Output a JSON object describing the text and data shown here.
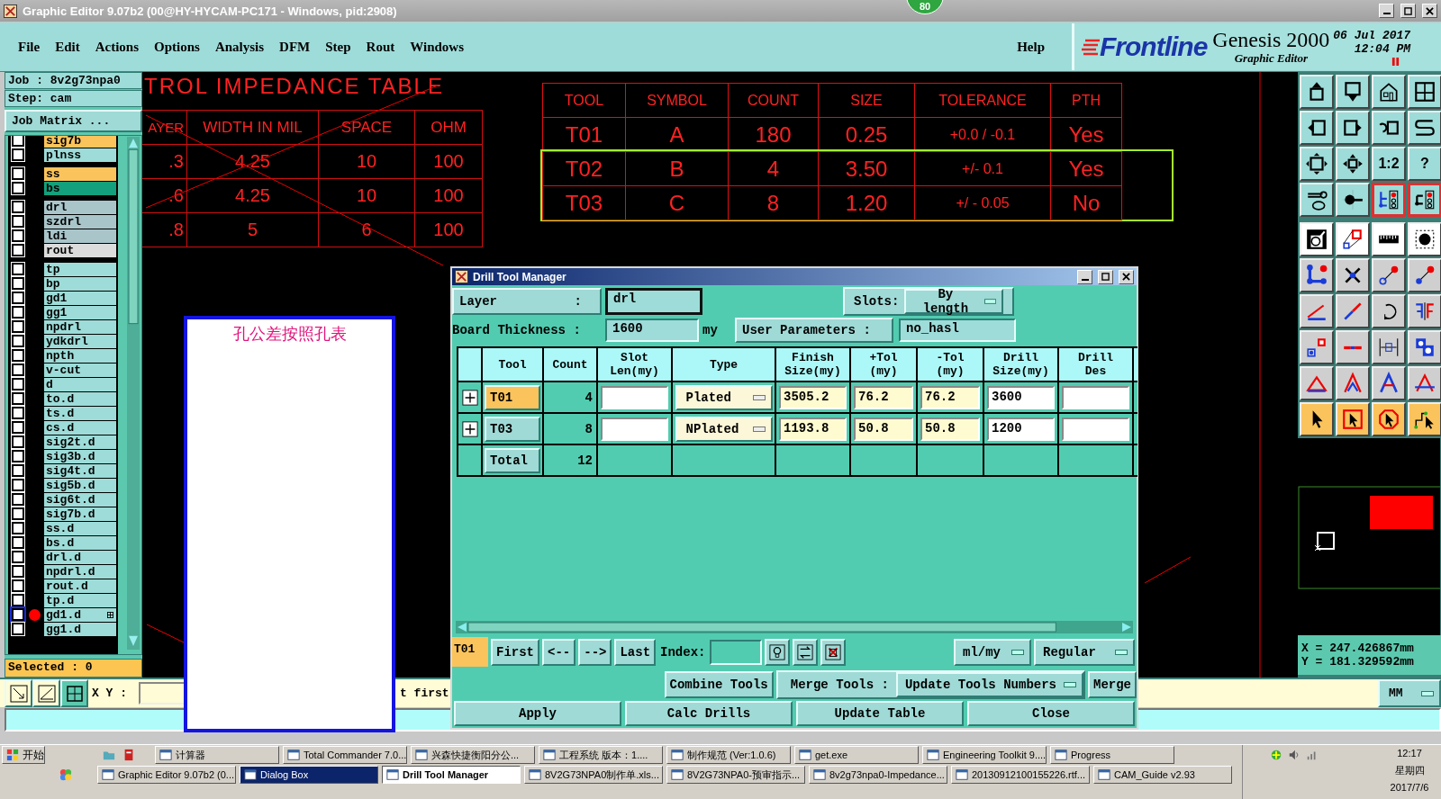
{
  "window": {
    "title": "Graphic Editor 9.07b2 (00@HY-HYCAM-PC171 - Windows, pid:2908)",
    "badge": "80"
  },
  "menu": [
    {
      "label": "File"
    },
    {
      "label": "Edit"
    },
    {
      "label": "Actions"
    },
    {
      "label": "Options"
    },
    {
      "label": "Analysis"
    },
    {
      "label": "DFM"
    },
    {
      "label": "Step"
    },
    {
      "label": "Rout"
    },
    {
      "label": "Windows"
    }
  ],
  "help": "Help",
  "brand": {
    "logo": "Frontline",
    "product": "Genesis 2000",
    "subtitle": "Graphic Editor",
    "date": "06 Jul 2017",
    "time": "12:04 PM"
  },
  "job_panel": {
    "job": "Job : 8v2g73npa0",
    "step": "Step: cam",
    "matrix_button": "Job Matrix ...",
    "selected": "Selected : 0",
    "layer_groups": [
      {
        "layers": [
          {
            "name": "sig7b",
            "color": "#fbc35b",
            "checked": false,
            "current": false
          },
          {
            "name": "plnss",
            "color": "#9ddcd8",
            "checked": false,
            "current": false
          }
        ]
      },
      {
        "layers": [
          {
            "name": "ss",
            "color": "#fbc35b",
            "checked": false,
            "current": false
          },
          {
            "name": "bs",
            "color": "#13a07c",
            "checked": false,
            "current": false
          }
        ]
      },
      {
        "layers": [
          {
            "name": "drl",
            "color": "#a9c5ca",
            "checked": false,
            "current": false
          },
          {
            "name": "szdrl",
            "color": "#a9c5ca",
            "checked": false,
            "current": false
          },
          {
            "name": "ldi",
            "color": "#a9c5ca",
            "checked": false,
            "current": false
          },
          {
            "name": "rout",
            "color": "#dcdcdc",
            "checked": false,
            "current": false
          }
        ]
      },
      {
        "layers": [
          {
            "name": "tp",
            "color": "#9ddcd8",
            "checked": false,
            "current": false
          },
          {
            "name": "bp",
            "color": "#9ddcd8",
            "checked": false,
            "current": false
          },
          {
            "name": "gd1",
            "color": "#9ddcd8",
            "checked": false,
            "current": false
          },
          {
            "name": "gg1",
            "color": "#9ddcd8",
            "checked": false,
            "current": false
          },
          {
            "name": "npdrl",
            "color": "#9ddcd8",
            "checked": false,
            "current": false
          },
          {
            "name": "ydkdrl",
            "color": "#9ddcd8",
            "checked": false,
            "current": false
          },
          {
            "name": "npth",
            "color": "#9ddcd8",
            "checked": false,
            "current": false
          },
          {
            "name": "v-cut",
            "color": "#9ddcd8",
            "checked": false,
            "current": false
          },
          {
            "name": "d",
            "color": "#9ddcd8",
            "checked": false,
            "current": false
          },
          {
            "name": "to.d",
            "color": "#9ddcd8",
            "checked": false,
            "current": false
          },
          {
            "name": "ts.d",
            "color": "#9ddcd8",
            "checked": false,
            "current": false
          },
          {
            "name": "cs.d",
            "color": "#9ddcd8",
            "checked": false,
            "current": false
          },
          {
            "name": "sig2t.d",
            "color": "#9ddcd8",
            "checked": false,
            "current": false
          },
          {
            "name": "sig3b.d",
            "color": "#9ddcd8",
            "checked": false,
            "current": false
          },
          {
            "name": "sig4t.d",
            "color": "#9ddcd8",
            "checked": false,
            "current": false
          },
          {
            "name": "sig5b.d",
            "color": "#9ddcd8",
            "checked": false,
            "current": false
          },
          {
            "name": "sig6t.d",
            "color": "#9ddcd8",
            "checked": false,
            "current": false
          },
          {
            "name": "sig7b.d",
            "color": "#9ddcd8",
            "checked": false,
            "current": false
          },
          {
            "name": "ss.d",
            "color": "#9ddcd8",
            "checked": false,
            "current": false
          },
          {
            "name": "bs.d",
            "color": "#9ddcd8",
            "checked": false,
            "current": false
          },
          {
            "name": "drl.d",
            "color": "#9ddcd8",
            "checked": false,
            "current": false
          },
          {
            "name": "npdrl.d",
            "color": "#9ddcd8",
            "checked": false,
            "current": false
          },
          {
            "name": "rout.d",
            "color": "#9ddcd8",
            "checked": false,
            "current": false
          },
          {
            "name": "tp.d",
            "color": "#9ddcd8",
            "checked": false,
            "current": false
          },
          {
            "name": "gd1.d",
            "color": "#9ddcd8",
            "checked": false,
            "current": true
          },
          {
            "name": "gg1.d",
            "color": "#9ddcd8",
            "checked": false,
            "current": false
          }
        ]
      }
    ]
  },
  "impedance_table": {
    "title": "TROL IMPEDANCE TABLE",
    "columns": [
      "AYER",
      "WIDTH IN MIL",
      "SPACE",
      "OHM"
    ],
    "rows": [
      [
        ".3",
        "4.25",
        "10",
        "100"
      ],
      [
        ".6",
        "4.25",
        "10",
        "100"
      ],
      [
        ".8",
        "5",
        "6",
        "100"
      ]
    ]
  },
  "drill_table": {
    "columns": [
      "TOOL",
      "SYMBOL",
      "COUNT",
      "SIZE",
      "TOLERANCE",
      "PTH"
    ],
    "rows": [
      {
        "cells": [
          "T01",
          "A",
          "180",
          "0.25",
          "+0.0 / -0.1",
          "Yes"
        ],
        "highlighted": false
      },
      {
        "cells": [
          "T02",
          "B",
          "4",
          "3.50",
          "+/-  0.1",
          "Yes"
        ],
        "highlighted": true
      },
      {
        "cells": [
          "T03",
          "C",
          "8",
          "1.20",
          "+/ - 0.05",
          "No"
        ],
        "highlighted": true
      }
    ]
  },
  "note": {
    "text": "孔公差按照孔表"
  },
  "toolbar": {
    "text_buttons": [
      {
        "label": "1:2"
      },
      {
        "label": "?"
      }
    ]
  },
  "coordinates": {
    "x": "X = 247.426867mm",
    "y": "Y = 181.329592mm"
  },
  "command_bar": {
    "xy_label": "X Y :",
    "prompt": "t first",
    "units": "MM"
  },
  "dialog": {
    "title": "Drill Tool Manager",
    "layer": {
      "label": "Layer",
      "separator": ":",
      "value": "drl"
    },
    "slots": {
      "label": "Slots:",
      "value": "By length"
    },
    "thickness": {
      "label": "Board Thickness :",
      "value": "1600",
      "unit": "my"
    },
    "user_parameters": {
      "button": "User Parameters :",
      "value": "no_hasl"
    },
    "table": {
      "columns": [
        "Tool",
        "Count",
        "Slot\nLen(my)",
        "Type",
        "Finish\nSize(my)",
        "+Tol\n(my)",
        "-Tol\n(my)",
        "Drill\nSize(my)",
        "Drill\nDes"
      ],
      "rows": [
        {
          "tool": "T01",
          "selected": true,
          "count": "4",
          "type": "Plated",
          "finish": "3505.2",
          "plus_tol": "76.2",
          "minus_tol": "76.2",
          "drill_size": "3600"
        },
        {
          "tool": "T03",
          "selected": false,
          "count": "8",
          "type": "NPlated",
          "finish": "1193.8",
          "plus_tol": "50.8",
          "minus_tol": "50.8",
          "drill_size": "1200"
        }
      ],
      "total": {
        "label": "Total",
        "count": "12"
      }
    },
    "nav": {
      "current": "T01",
      "buttons": [
        "First",
        "<--",
        "-->",
        "Last"
      ],
      "index_label": "Index:",
      "units": "ml/my",
      "mode": "Regular"
    },
    "merge": {
      "combine": "Combine Tools",
      "label": "Merge Tools :",
      "option": "Update Tools Numbers",
      "button": "Merge"
    },
    "actions": [
      "Apply",
      "Calc Drills",
      "Update Table",
      "Close"
    ]
  },
  "taskbar": {
    "start": "开始",
    "row_1": [
      {
        "label": "计算器",
        "selected": false
      },
      {
        "label": "Total Commander 7.0...",
        "selected": false
      },
      {
        "label": "兴森快捷衡阳分公...",
        "selected": false
      },
      {
        "label": "工程系统  版本：1....",
        "selected": false
      },
      {
        "label": "制作规范 (Ver:1.0.6)",
        "selected": false
      },
      {
        "label": "get.exe",
        "selected": false
      },
      {
        "label": "Engineering Toolkit 9....",
        "selected": false
      },
      {
        "label": "Progress",
        "selected": false
      }
    ],
    "row_2": [
      {
        "label": "Graphic Editor 9.07b2 (0...",
        "selected": false,
        "highlighted": false
      },
      {
        "label": "Dialog Box",
        "selected": false,
        "highlighted": true
      },
      {
        "label": "Drill Tool Manager",
        "selected": true,
        "highlighted": false
      },
      {
        "label": "8V2G73NPA0制作单.xls...",
        "selected": false,
        "highlighted": false
      },
      {
        "label": "8V2G73NPA0-预审指示...",
        "selected": false,
        "highlighted": false
      },
      {
        "label": "8v2g73npa0-Impedance...",
        "selected": false,
        "highlighted": false
      },
      {
        "label": "20130912100155226.rtf...",
        "selected": false,
        "highlighted": false
      },
      {
        "label": "CAM_Guide v2.93",
        "selected": false,
        "highlighted": false
      }
    ],
    "clock": {
      "time": "12:17",
      "weekday": "星期四",
      "date": "2017/7/6"
    }
  }
}
